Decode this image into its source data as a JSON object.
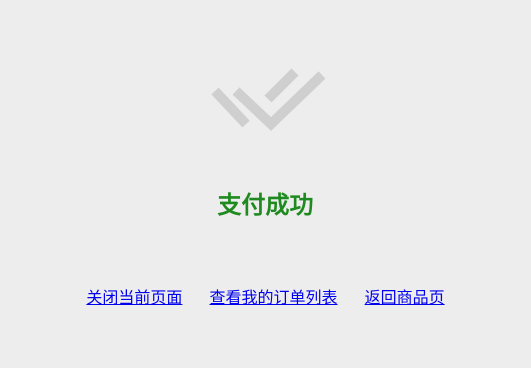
{
  "status": {
    "icon": "double-check-icon",
    "title": "支付成功",
    "title_color": "#1f8a1f"
  },
  "links": {
    "close_page": "关闭当前页面",
    "view_orders": "查看我的订单列表",
    "back_to_product": "返回商品页",
    "link_color": "#0000ee"
  },
  "colors": {
    "background": "#ededed",
    "icon": "#cfcfcf"
  }
}
